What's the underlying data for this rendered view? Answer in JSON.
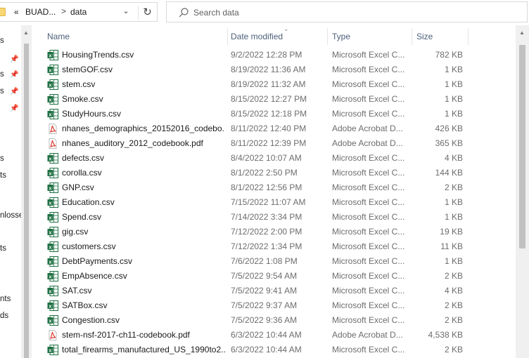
{
  "address": {
    "prefix": "«",
    "parent": "BUAD...",
    "separator": ">",
    "current": "data"
  },
  "search": {
    "placeholder": "Search data"
  },
  "nav": {
    "items": [
      {
        "label": "s"
      },
      {
        "label": "s"
      },
      {
        "label": "s"
      },
      {
        "label": "s"
      },
      {
        "label": "ts"
      },
      {
        "label": "nlosse"
      },
      {
        "label": "ts"
      },
      {
        "label": "nts"
      },
      {
        "label": "ds"
      }
    ]
  },
  "columns": {
    "name": "Name",
    "date": "Date modified",
    "type": "Type",
    "size": "Size"
  },
  "files": [
    {
      "name": "HousingTrends.csv",
      "date": "9/2/2022 12:28 PM",
      "type": "Microsoft Excel C...",
      "size": "782 KB",
      "icon": "excel-icon"
    },
    {
      "name": "stemGOF.csv",
      "date": "8/19/2022 11:36 AM",
      "type": "Microsoft Excel C...",
      "size": "1 KB",
      "icon": "excel-icon"
    },
    {
      "name": "stem.csv",
      "date": "8/19/2022 11:32 AM",
      "type": "Microsoft Excel C...",
      "size": "1 KB",
      "icon": "excel-icon"
    },
    {
      "name": "Smoke.csv",
      "date": "8/15/2022 12:27 PM",
      "type": "Microsoft Excel C...",
      "size": "1 KB",
      "icon": "excel-icon"
    },
    {
      "name": "StudyHours.csv",
      "date": "8/15/2022 12:18 PM",
      "type": "Microsoft Excel C...",
      "size": "1 KB",
      "icon": "excel-icon"
    },
    {
      "name": "nhanes_demographics_20152016_codebo...",
      "date": "8/11/2022 12:40 PM",
      "type": "Adobe Acrobat D...",
      "size": "426 KB",
      "icon": "pdf-icon"
    },
    {
      "name": "nhanes_auditory_2012_codebook.pdf",
      "date": "8/11/2022 12:39 PM",
      "type": "Adobe Acrobat D...",
      "size": "365 KB",
      "icon": "pdf-icon"
    },
    {
      "name": "defects.csv",
      "date": "8/4/2022 10:07 AM",
      "type": "Microsoft Excel C...",
      "size": "4 KB",
      "icon": "excel-icon"
    },
    {
      "name": "corolla.csv",
      "date": "8/1/2022 2:50 PM",
      "type": "Microsoft Excel C...",
      "size": "144 KB",
      "icon": "excel-icon"
    },
    {
      "name": "GNP.csv",
      "date": "8/1/2022 12:56 PM",
      "type": "Microsoft Excel C...",
      "size": "2 KB",
      "icon": "excel-icon"
    },
    {
      "name": "Education.csv",
      "date": "7/15/2022 11:07 AM",
      "type": "Microsoft Excel C...",
      "size": "1 KB",
      "icon": "excel-icon"
    },
    {
      "name": "Spend.csv",
      "date": "7/14/2022 3:34 PM",
      "type": "Microsoft Excel C...",
      "size": "1 KB",
      "icon": "excel-icon"
    },
    {
      "name": "gig.csv",
      "date": "7/12/2022 2:00 PM",
      "type": "Microsoft Excel C...",
      "size": "19 KB",
      "icon": "excel-icon"
    },
    {
      "name": "customers.csv",
      "date": "7/12/2022 1:34 PM",
      "type": "Microsoft Excel C...",
      "size": "11 KB",
      "icon": "excel-icon"
    },
    {
      "name": "DebtPayments.csv",
      "date": "7/6/2022 1:08 PM",
      "type": "Microsoft Excel C...",
      "size": "1 KB",
      "icon": "excel-icon"
    },
    {
      "name": "EmpAbsence.csv",
      "date": "7/5/2022 9:54 AM",
      "type": "Microsoft Excel C...",
      "size": "2 KB",
      "icon": "excel-icon"
    },
    {
      "name": "SAT.csv",
      "date": "7/5/2022 9:41 AM",
      "type": "Microsoft Excel C...",
      "size": "4 KB",
      "icon": "excel-icon"
    },
    {
      "name": "SATBox.csv",
      "date": "7/5/2022 9:37 AM",
      "type": "Microsoft Excel C...",
      "size": "2 KB",
      "icon": "excel-icon"
    },
    {
      "name": "Congestion.csv",
      "date": "7/5/2022 9:36 AM",
      "type": "Microsoft Excel C...",
      "size": "2 KB",
      "icon": "excel-icon"
    },
    {
      "name": "stem-nsf-2017-ch11-codebook.pdf",
      "date": "6/3/2022 10:44 AM",
      "type": "Adobe Acrobat D...",
      "size": "4,538 KB",
      "icon": "pdf-icon"
    },
    {
      "name": "total_firearms_manufactured_US_1990to2...",
      "date": "6/3/2022 10:44 AM",
      "type": "Microsoft Excel C...",
      "size": "2 KB",
      "icon": "excel-icon"
    }
  ],
  "colors": {
    "excel": "#1d6f42",
    "pdf": "#d93025",
    "header_text": "#4c607a",
    "folder": "#f8d775"
  }
}
